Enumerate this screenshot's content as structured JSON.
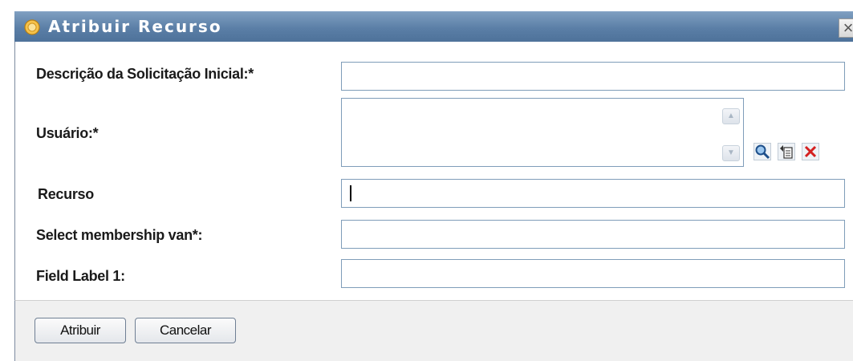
{
  "dialog": {
    "title": "Atribuir Recurso",
    "close_label": "×"
  },
  "form": {
    "fields": [
      {
        "label": "Descrição da Solicitação Inicial:*",
        "value": ""
      },
      {
        "label": "Usuário:*",
        "value": ""
      },
      {
        "label": "Recurso",
        "value": ""
      },
      {
        "label": "Select membership van*:",
        "value": ""
      },
      {
        "label": "Field Label 1:",
        "value": ""
      }
    ],
    "user_actions": {
      "search_icon": "magnifier-icon",
      "history_icon": "history-list-icon",
      "clear_icon": "red-x-clear-icon"
    }
  },
  "footer": {
    "assign_label": "Atribuir",
    "cancel_label": "Cancelar"
  },
  "colors": {
    "titlebar": "#5a7ea6",
    "field_border": "#7f9db9",
    "footer_bg": "#f0f0f0"
  }
}
